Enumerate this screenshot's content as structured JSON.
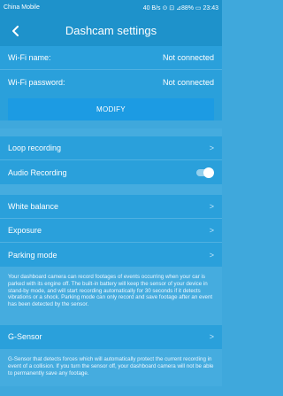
{
  "status": {
    "carrier": "China Mobile",
    "right_text": "40 B/s ⊙ ⊡ ⊿88% ▭ 23:43"
  },
  "header": {
    "title": "Dashcam settings"
  },
  "wifi": {
    "name_label": "Wi-Fi name:",
    "name_value": "Not connected",
    "password_label": "Wi-Fi password:",
    "password_value": "Not connected",
    "modify_label": "MODIFY"
  },
  "recording": {
    "loop_label": "Loop recording",
    "audio_label": "Audio Recording",
    "audio_enabled": false
  },
  "image": {
    "white_balance_label": "White balance",
    "exposure_label": "Exposure",
    "parking_label": "Parking mode",
    "parking_note": "Your dashboard camera can record footages of events occurring when your car is parked with its engine off. The built-in battery will keep the sensor of your device in stand-by mode, and will start recording automatically for 30 seconds if it detects vibrations or a shock. Parking mode can only record and save footage after an event has been detected by the sensor."
  },
  "gsensor": {
    "label": "G-Sensor",
    "note": "G-Sensor that detects forces which will automatically protect the current recording in event of a collision. If you turn the sensor off, your dashboard camera will not be able to permanently save any footage."
  }
}
